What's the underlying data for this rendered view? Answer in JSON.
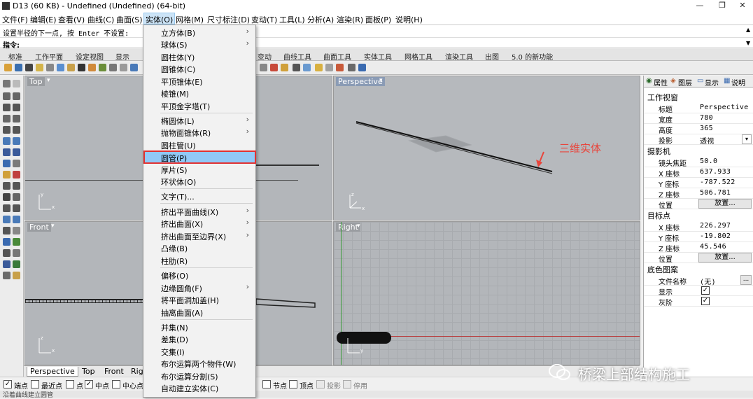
{
  "window": {
    "title": "D13 (60 KB) - Undefined (Undefined) (64-bit)",
    "minimize": "—",
    "maximize": "❐",
    "close": "✕"
  },
  "menubar": [
    {
      "label": "文件(F)"
    },
    {
      "label": "编辑(E)"
    },
    {
      "label": "查看(V)"
    },
    {
      "label": "曲线(C)"
    },
    {
      "label": "曲面(S)"
    },
    {
      "label": "实体(O)"
    },
    {
      "label": "网格(M)"
    },
    {
      "label": "尺寸标注(D)"
    },
    {
      "label": "变动(T)"
    },
    {
      "label": "工具(L)"
    },
    {
      "label": "分析(A)"
    },
    {
      "label": "渲染(R)"
    },
    {
      "label": "面板(P)"
    },
    {
      "label": "说明(H)"
    }
  ],
  "command": {
    "history": "设置半径的下一点, 按 Enter 不设置:",
    "prompt": "指令:"
  },
  "toolbar_tabs": [
    "标准",
    "工作平面",
    "设定视图",
    "显示",
    "变动",
    "曲线工具",
    "曲面工具",
    "实体工具",
    "网格工具",
    "渲染工具",
    "出图",
    "5.0 的新功能"
  ],
  "viewports": {
    "top": {
      "label": "Top"
    },
    "perspective": {
      "label": "Perspective"
    },
    "front": {
      "label": "Front"
    },
    "right": {
      "label": "Right"
    }
  },
  "viewport_tabs": [
    "Perspective",
    "Top",
    "Front",
    "Rig"
  ],
  "annotation": "三维实体",
  "watermark": "桥梁上部结构施工",
  "solid_menu": [
    {
      "label": "立方体(B)",
      "submenu": true
    },
    {
      "label": "球体(S)",
      "submenu": true
    },
    {
      "label": "圆柱体(Y)"
    },
    {
      "label": "圆锥体(C)"
    },
    {
      "label": "平顶锥体(E)"
    },
    {
      "label": "棱锥(M)"
    },
    {
      "label": "平顶金字塔(T)"
    },
    {
      "label": "椭圆体(L)",
      "submenu": true
    },
    {
      "label": "抛物面锥体(R)",
      "submenu": true
    },
    {
      "label": "圆柱管(U)"
    },
    {
      "label": "圆管(P)",
      "highlighted": true
    },
    {
      "label": "厚片(S)"
    },
    {
      "label": "环状体(O)"
    },
    {
      "label": "文字(T)..."
    },
    {
      "label": "挤出平面曲线(X)",
      "submenu": true
    },
    {
      "label": "挤出曲面(X)",
      "submenu": true
    },
    {
      "label": "挤出曲面至边界(X)",
      "submenu": true
    },
    {
      "label": "凸缘(B)"
    },
    {
      "label": "柱肋(R)"
    },
    {
      "label": "偏移(O)"
    },
    {
      "label": "边缘圆角(F)",
      "submenu": true
    },
    {
      "label": "将平面洞加盖(H)"
    },
    {
      "label": "抽离曲面(A)"
    },
    {
      "label": "并集(N)"
    },
    {
      "label": "差集(D)"
    },
    {
      "label": "交集(I)"
    },
    {
      "label": "布尔运算两个物件(W)"
    },
    {
      "label": "布尔运算分割(S)"
    },
    {
      "label": "自动建立实体(C)"
    }
  ],
  "properties": {
    "tabs": [
      "属性",
      "图层",
      "显示",
      "说明"
    ],
    "section_viewport": "工作视窗",
    "title_k": "标题",
    "title_v": "Perspective",
    "width_k": "宽度",
    "width_v": "780",
    "height_k": "高度",
    "height_v": "365",
    "proj_k": "投影",
    "proj_v": "透视",
    "section_camera": "摄影机",
    "lens_k": "镜头焦距",
    "lens_v": "50.0",
    "cx_k": "X 座标",
    "cx_v": "637.933",
    "cy_k": "Y 座标",
    "cy_v": "-787.522",
    "cz_k": "Z 座标",
    "cz_v": "506.781",
    "cpos_k": "位置",
    "cpos_btn": "放置...",
    "section_target": "目标点",
    "tx_k": "X 座标",
    "tx_v": "226.297",
    "ty_k": "Y 座标",
    "ty_v": "-19.802",
    "tz_k": "Z 座标",
    "tz_v": "45.546",
    "tpos_k": "位置",
    "tpos_btn": "放置...",
    "section_bg": "底色图案",
    "file_k": "文件名称",
    "file_v": "(无)",
    "file_btn": "...",
    "show_k": "显示",
    "gray_k": "灰阶"
  },
  "osnap": {
    "end": "端点",
    "near": "最近点",
    "point": "点",
    "mid": "中点",
    "center": "中心点",
    "knot": "节点",
    "vertex": "顶点",
    "project": "投影",
    "disable": "停用"
  },
  "status": "沿着曲线建立圆管"
}
